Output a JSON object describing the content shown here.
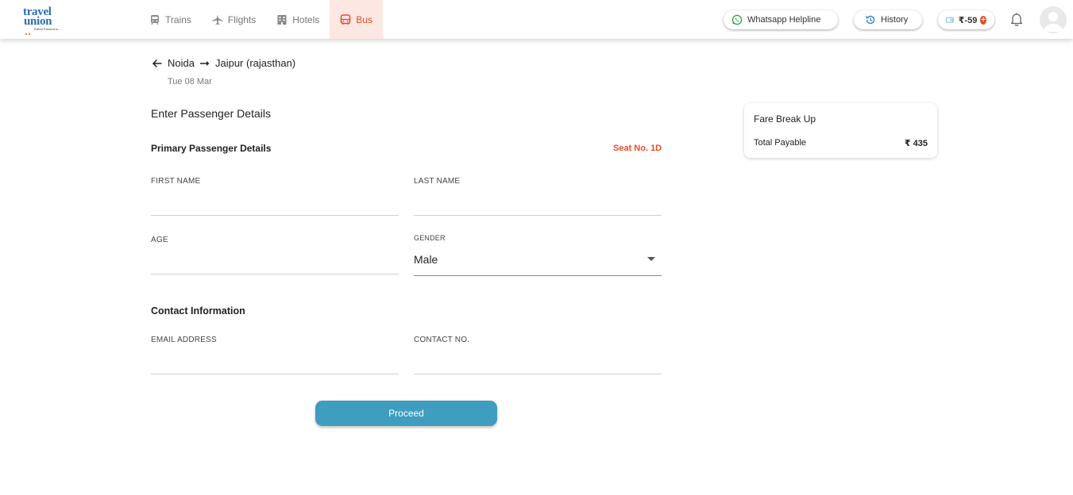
{
  "brand": {
    "logo_line1": "travel",
    "logo_line2": "union",
    "logo_tagline": "Rahat Pahuncha ..."
  },
  "nav": {
    "items": [
      {
        "label": "Trains",
        "icon": "train-icon"
      },
      {
        "label": "Flights",
        "icon": "plane-icon"
      },
      {
        "label": "Hotels",
        "icon": "hotel-icon"
      },
      {
        "label": "Bus",
        "icon": "bus-icon",
        "active": true
      }
    ]
  },
  "header": {
    "whatsapp_label": "Whatsapp Helpline",
    "history_label": "History",
    "wallet_amount": "₹-59"
  },
  "trip": {
    "from": "Noida",
    "to": "Jaipur (rajasthan)",
    "date": "Tue 08 Mar"
  },
  "form": {
    "heading": "Enter Passenger Details",
    "primary_heading": "Primary Passenger Details",
    "seat": "Seat No. 1D",
    "first_name_label": "FIRST NAME",
    "last_name_label": "LAST NAME",
    "age_label": "AGE",
    "gender_label": "GENDER",
    "gender_value": "Male",
    "contact_heading": "Contact Information",
    "email_label": "EMAIL ADDRESS",
    "contact_label": "CONTACT NO.",
    "proceed_label": "Proceed"
  },
  "fare": {
    "title": "Fare Break Up",
    "total_label": "Total Payable",
    "total_value": "₹ 435"
  },
  "colors": {
    "accent": "#e84b2c",
    "brand_blue": "#2b6cb0",
    "button": "#3f9dbf"
  }
}
